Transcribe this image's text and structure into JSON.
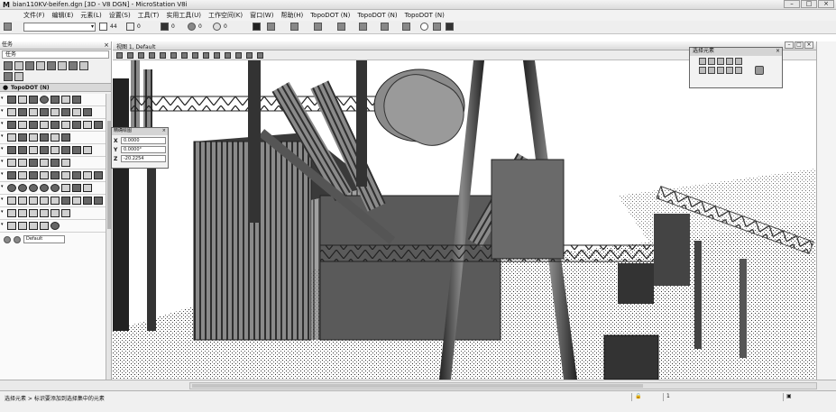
{
  "window": {
    "title": "bian110KV-beifen.dgn [3D - V8 DGN] - MicroStation V8i",
    "app_icon": "microstation-icon"
  },
  "menu": [
    "文件(F)",
    "编辑(E)",
    "元素(L)",
    "设置(S)",
    "工具(T)",
    "实用工具(U)",
    "工作空间(K)",
    "窗口(W)",
    "帮助(H)",
    "TopoDOT (N)",
    "TopoDOT (N)",
    "TopoDOT (N)"
  ],
  "toolbar": {
    "level_combo": "",
    "color_value": "44",
    "weight_value": "0",
    "style_value": "0",
    "transparency_value": "0",
    "priority_value": "0"
  },
  "left_panel": {
    "title": "任务",
    "task_combo": "任务",
    "topodot_header": "TopoDOT (N)",
    "bottom_combo": "Default"
  },
  "view": {
    "title": "视图 1, Default"
  },
  "coord_dialog": {
    "title": "精确绘图",
    "labels": [
      "X",
      "Y",
      "Z"
    ],
    "x_value": "0.0000",
    "y_value": "0.0000°",
    "z_value": "-20.2254"
  },
  "select_dialog": {
    "title": "选择元素"
  },
  "status": {
    "prompt": "选择元素 > 标识要添加到选择集中的元素",
    "right_value": "1"
  },
  "colors": {
    "chrome": "#f0f0f0",
    "viewport_bg": "#ffffff",
    "pointcloud": "#2a2a2a"
  }
}
